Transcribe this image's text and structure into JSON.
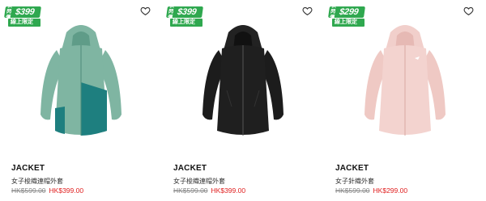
{
  "products": [
    {
      "badge": {
        "label": "快閃價",
        "price": "$399",
        "tag": "線上限定款"
      },
      "name": "JACKET",
      "subtitle": "女子梭織連帽外套",
      "original_price": "HK$599.00",
      "sale_price": "HK$399.00",
      "colors": {
        "main": "#7fb5a2",
        "accent": "#1e7f7f",
        "shade": "#6aa593"
      }
    },
    {
      "badge": {
        "label": "快閃價",
        "price": "$399",
        "tag": "線上限定款"
      },
      "name": "JACKET",
      "subtitle": "女子梭織連帽外套",
      "original_price": "HK$599.00",
      "sale_price": "HK$399.00",
      "colors": {
        "main": "#1c1c1c",
        "accent": "#0f0f0f",
        "shade": "#2b2b2b"
      }
    },
    {
      "badge": {
        "label": "快閃價",
        "price": "$299",
        "tag": "線上限定款"
      },
      "name": "JACKET",
      "subtitle": "女子針織外套",
      "original_price": "HK$599.00",
      "sale_price": "HK$299.00",
      "colors": {
        "main": "#f1cfcb",
        "accent": "#e7bcb7",
        "shade": "#e9c3bf"
      }
    }
  ],
  "icons": {
    "wishlist": "heart-outline-icon"
  },
  "theme": {
    "badge_green": "#2fa84f",
    "sale_red": "#e02020"
  }
}
